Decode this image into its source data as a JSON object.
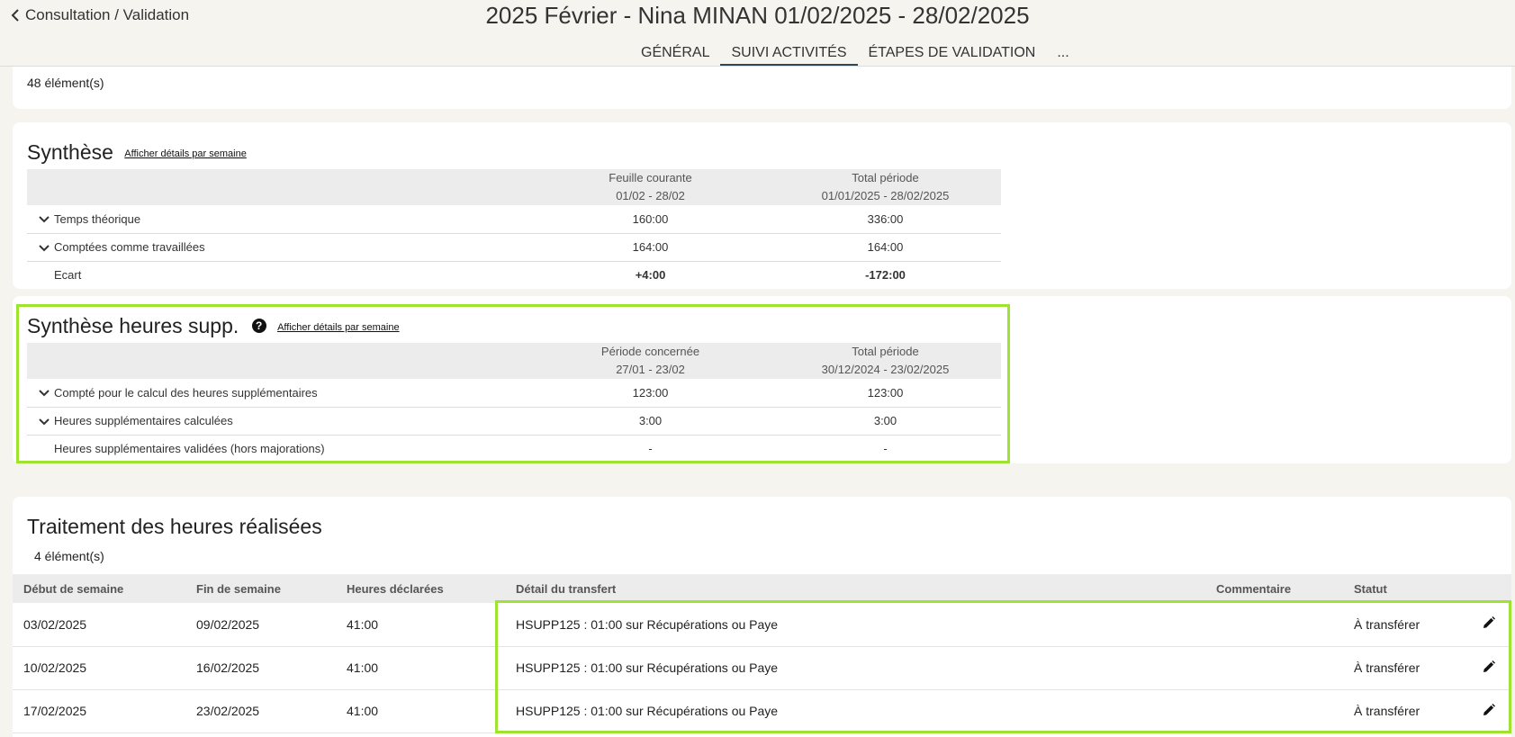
{
  "header": {
    "back_label": "Consultation / Validation",
    "title": "2025 Février - Nina MINAN 01/02/2025 - 28/02/2025",
    "tabs": [
      "GÉNÉRAL",
      "SUIVI ACTIVITÉS",
      "ÉTAPES DE VALIDATION",
      "..."
    ],
    "active_tab": "SUIVI ACTIVITÉS"
  },
  "top_count": "48 élément(s)",
  "synthese": {
    "title": "Synthèse",
    "link": "Afficher détails par semaine",
    "headers": {
      "col2_line1": "Feuille courante",
      "col2_line2": "01/02 - 28/02",
      "col3_line1": "Total période",
      "col3_line2": "01/01/2025 - 28/02/2025"
    },
    "rows": [
      {
        "label": "Temps théorique",
        "v1": "160:00",
        "v2": "336:00"
      },
      {
        "label": "Comptées comme travaillées",
        "v1": "164:00",
        "v2": "164:00"
      },
      {
        "label": "Ecart",
        "v1": "+4:00",
        "v2": "-172:00"
      }
    ]
  },
  "hsupp": {
    "title": "Synthèse heures supp.",
    "link": "Afficher détails par semaine",
    "headers": {
      "col2_line1": "Période concernée",
      "col2_line2": "27/01 - 23/02",
      "col3_line1": "Total période",
      "col3_line2": "30/12/2024 - 23/02/2025"
    },
    "rows": [
      {
        "label": "Compté pour le calcul des heures supplémentaires",
        "v1": "123:00",
        "v2": "123:00"
      },
      {
        "label": "Heures supplémentaires calculées",
        "v1": "3:00",
        "v2": "3:00"
      },
      {
        "label": "Heures supplémentaires validées (hors majorations)",
        "v1": "-",
        "v2": "-"
      }
    ]
  },
  "traitement": {
    "title": "Traitement des heures réalisées",
    "count": "4 élément(s)",
    "columns": [
      "Début de semaine",
      "Fin de semaine",
      "Heures déclarées",
      "Détail du transfert",
      "Commentaire",
      "Statut"
    ],
    "rows": [
      {
        "start": "03/02/2025",
        "end": "09/02/2025",
        "hours": "41:00",
        "detail": "HSUPP125 : 01:00 sur Récupérations ou Paye",
        "comment": "",
        "status": "À transférer"
      },
      {
        "start": "10/02/2025",
        "end": "16/02/2025",
        "hours": "41:00",
        "detail": "HSUPP125 : 01:00 sur Récupérations ou Paye",
        "comment": "",
        "status": "À transférer"
      },
      {
        "start": "17/02/2025",
        "end": "23/02/2025",
        "hours": "41:00",
        "detail": "HSUPP125 : 01:00 sur Récupérations ou Paye",
        "comment": "",
        "status": "À transférer"
      }
    ]
  },
  "colors": {
    "highlight": "#9de330",
    "tab_underline": "#2f4858",
    "background": "#f6f4ef"
  }
}
